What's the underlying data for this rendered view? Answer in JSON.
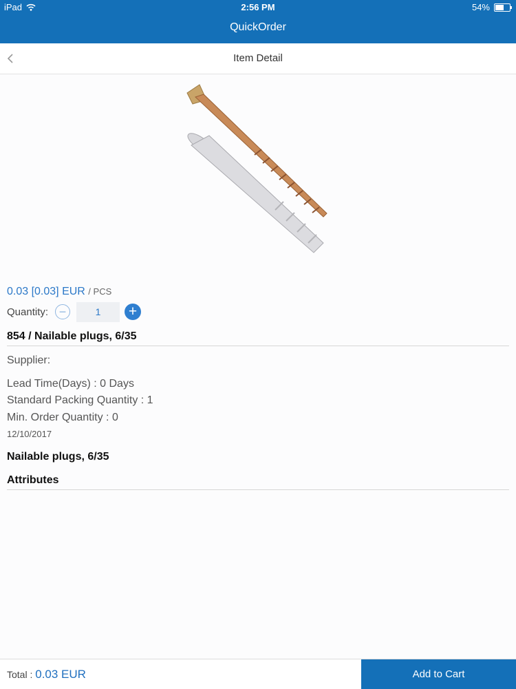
{
  "status_bar": {
    "device": "iPad",
    "time": "2:56 PM",
    "battery": "54%",
    "battery_level": 0.54
  },
  "app": {
    "title": "QuickOrder"
  },
  "nav": {
    "title": "Item Detail"
  },
  "item": {
    "price": "0.03 [0.03] EUR",
    "unit": "/ PCS",
    "quantity_label": "Quantity:",
    "quantity_value": "1",
    "title": "854 / Nailable plugs, 6/35",
    "supplier": "Supplier:",
    "lead_time": "Lead Time(Days) : 0 Days",
    "standard_packing": "Standard Packing Quantity : 1",
    "min_order": "Min. Order Quantity : 0",
    "date": "12/10/2017",
    "description": "Nailable plugs, 6/35",
    "attributes_label": "Attributes"
  },
  "footer": {
    "total_label": "Total :",
    "total_value": "0.03 EUR",
    "add_to_cart": "Add to Cart"
  },
  "icons": {
    "back": "chevron-left-icon",
    "minus": "minus-icon",
    "plus": "plus-icon",
    "wifi": "wifi-icon",
    "battery": "battery-icon"
  },
  "colors": {
    "accent": "#1470b8",
    "link": "#2b78c8"
  }
}
